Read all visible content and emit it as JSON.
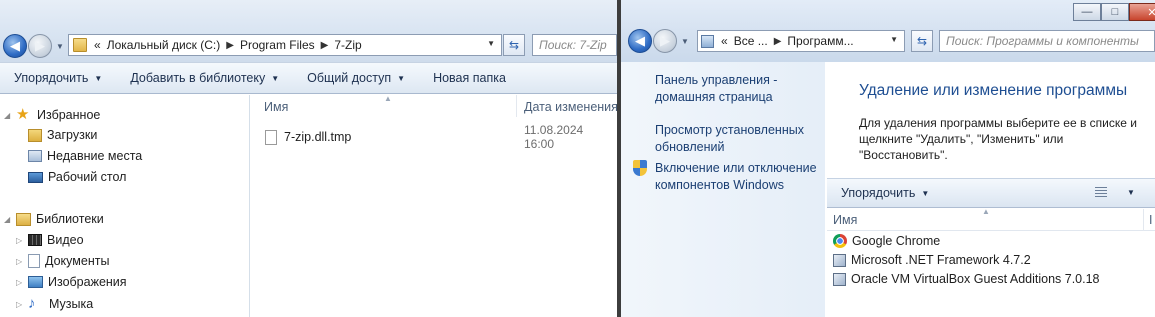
{
  "explorer": {
    "address": {
      "overflow": "«",
      "segments": [
        "Локальный диск (C:)",
        "Program Files",
        "7-Zip"
      ]
    },
    "search_placeholder": "Поиск: 7-Zip",
    "toolbar": {
      "organize": "Упорядочить",
      "add_to_library": "Добавить в библиотеку",
      "share": "Общий доступ",
      "new_folder": "Новая папка"
    },
    "nav": {
      "favorites": "Избранное",
      "downloads": "Загрузки",
      "recent": "Недавние места",
      "desktop": "Рабочий стол",
      "libraries": "Библиотеки",
      "video": "Видео",
      "documents": "Документы",
      "pictures": "Изображения",
      "music": "Музыка"
    },
    "columns": {
      "name": "Имя",
      "date_modified": "Дата изменения"
    },
    "files": [
      {
        "name": "7-zip.dll.tmp",
        "date": "11.08.2024 16:00"
      }
    ]
  },
  "control_panel": {
    "address": {
      "overflow": "«",
      "segments": [
        "Все ...",
        "Программ..."
      ]
    },
    "search_placeholder": "Поиск: Программы и компоненты",
    "caption": {
      "minimize": "—",
      "maximize": "□",
      "close": "✕"
    },
    "sidebar": {
      "home_link": "Панель управления - домашняя страница",
      "view_updates_link": "Просмотр установленных обновлений",
      "features_link": "Включение или отключение компонентов Windows"
    },
    "title": "Удаление или изменение программы",
    "description": "Для удаления программы выберите ее в списке и щелкните \"Удалить\", \"Изменить\" или \"Восстановить\".",
    "toolbar": {
      "organize": "Упорядочить"
    },
    "columns": {
      "name": "Имя",
      "publisher_partial": "I"
    },
    "programs": [
      {
        "name": "Google Chrome",
        "icon": "chrome-icon"
      },
      {
        "name": "Microsoft .NET Framework 4.7.2",
        "icon": "installer-icon"
      },
      {
        "name": "Oracle VM VirtualBox Guest Additions 7.0.18",
        "icon": "installer-icon"
      }
    ]
  },
  "colors": {
    "link": "#1b3f73",
    "title": "#1e4e92",
    "accent": "#2f6cc5"
  }
}
